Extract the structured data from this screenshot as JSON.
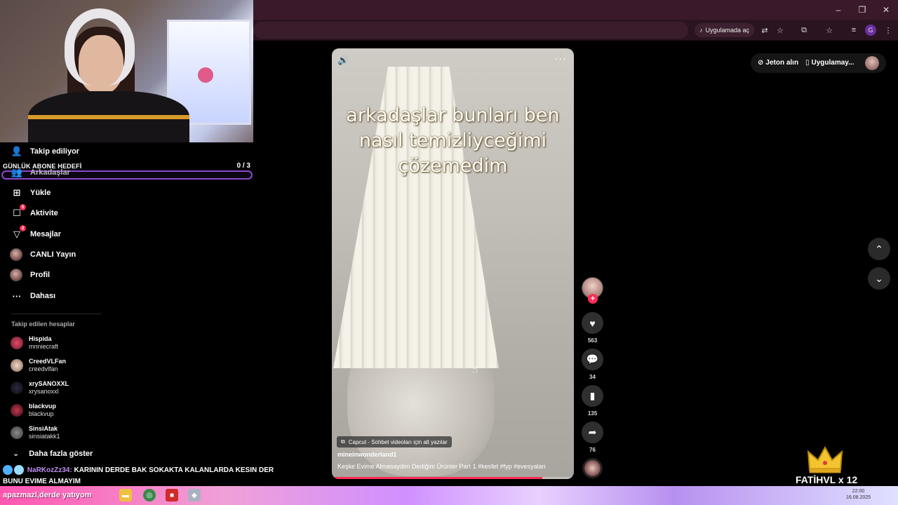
{
  "browser": {
    "open_in_app_label": "Uygulamada aç",
    "profile_letter": "G",
    "window_controls": [
      "–",
      "❐",
      "✕"
    ]
  },
  "stream_overlay": {
    "goal_title": "GÜNLÜK ABONE HEDEFİ",
    "goal_count": "0 / 3",
    "goal_progress": 0,
    "chat_user": "NaRKozZz34:",
    "chat_message": "KARININ DERDE BAK SOKAKTA KALANLARDA KESIN DER BUNU EVIME ALMAYIM",
    "donor_label": "FATİHVL  x 12",
    "ticker_text": "apazmazl,derde yatıyom"
  },
  "sidebar": {
    "nav": [
      {
        "label": "Takip ediliyor",
        "icon": "following-icon",
        "glyph": "👤"
      },
      {
        "label": "Arkadaşlar",
        "icon": "friends-icon",
        "glyph": "👥"
      },
      {
        "label": "Yükle",
        "icon": "upload-icon",
        "glyph": "⊞"
      },
      {
        "label": "Aktivite",
        "icon": "activity-icon",
        "glyph": "☐",
        "badge": "5"
      },
      {
        "label": "Mesajlar",
        "icon": "messages-icon",
        "glyph": "▽",
        "badge": "2"
      },
      {
        "label": "CANLI Yayın",
        "icon": "live-avatar"
      },
      {
        "label": "Profil",
        "icon": "profile-avatar"
      },
      {
        "label": "Dahası",
        "icon": "more-icon",
        "glyph": "···"
      }
    ],
    "following_title": "Takip edilen hesaplar",
    "following": [
      {
        "name": "Hispida",
        "handle": "mnniecraft"
      },
      {
        "name": "CreedVLFan",
        "handle": "creedvlfan"
      },
      {
        "name": "xrySANOXXL",
        "handle": "xrysanoxxl"
      },
      {
        "name": "blackvup",
        "handle": "blackvup"
      },
      {
        "name": "SinsiAtak",
        "handle": "sinsiatakk1"
      }
    ],
    "show_more": "Daha fazla göster"
  },
  "video": {
    "caption_lines": [
      "arkadaşlar bunları ben",
      "nasıl temizliyceğimi",
      "çözemedim"
    ],
    "capcut_label": "Capcut - Sohbet videoları için alt yazılar",
    "author": "mineinwonderland1",
    "description": "Keşke Evime Almasaydim Dediğim Ürünler Part 1 #kesfet  #fyp  #evesyalari",
    "progress": 0.87
  },
  "actions": {
    "likes": "563",
    "comments": "34",
    "saves": "135",
    "shares": "76"
  },
  "top_right": {
    "coins_label": "Jeton alın",
    "app_label": "Uygulamay..."
  },
  "taskbar": {
    "clock_time": "22:00",
    "clock_date": "16.08.2025"
  }
}
